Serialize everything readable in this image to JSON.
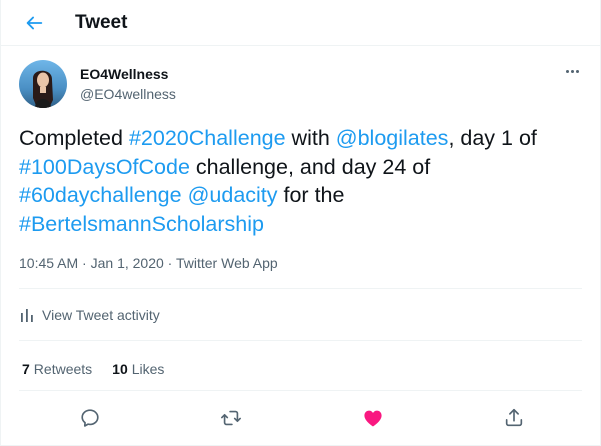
{
  "header": {
    "title": "Tweet"
  },
  "author": {
    "name": "EO4Wellness",
    "handle": "@EO4wellness"
  },
  "tweet": {
    "segments": [
      {
        "text": "Completed ",
        "link": false
      },
      {
        "text": "#2020Challenge",
        "link": true
      },
      {
        "text": " with ",
        "link": false
      },
      {
        "text": "@blogilates",
        "link": true
      },
      {
        "text": ", day 1 of ",
        "link": false
      },
      {
        "text": "#100DaysOfCode",
        "link": true
      },
      {
        "text": " challenge, and day 24 of ",
        "link": false
      },
      {
        "text": "#60daychallenge",
        "link": true
      },
      {
        "text": " ",
        "link": false
      },
      {
        "text": "@udacity",
        "link": true
      },
      {
        "text": " for the ",
        "link": false
      },
      {
        "text": "#BertelsmannScholarship",
        "link": true
      }
    ],
    "time": "10:45 AM",
    "separator": "·",
    "date": "Jan 1, 2020",
    "source": "Twitter Web App"
  },
  "activity": {
    "label": "View Tweet activity"
  },
  "stats": {
    "retweets_count": "7",
    "retweets_label": "Retweets",
    "likes_count": "10",
    "likes_label": "Likes"
  },
  "icons": {
    "back": "arrow-left-icon",
    "more": "more-horizontal-icon",
    "activity": "bar-chart-icon",
    "reply": "reply-icon",
    "retweet": "retweet-icon",
    "like": "heart-icon",
    "share": "share-icon"
  },
  "colors": {
    "accent": "#1d9bf0",
    "like_active": "#f91880",
    "text_primary": "#0f1419",
    "text_secondary": "#536471"
  },
  "state": {
    "liked": true
  }
}
